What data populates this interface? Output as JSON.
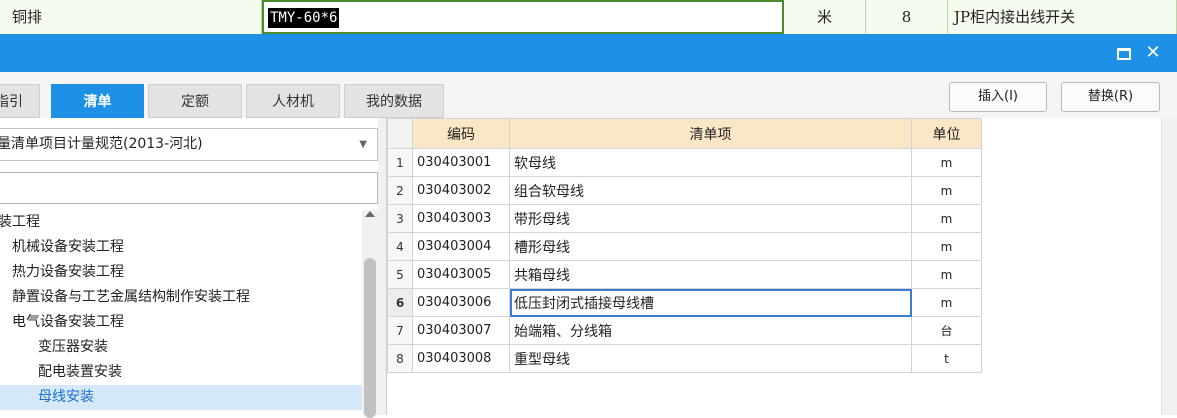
{
  "background_row": {
    "material": "铜排",
    "spec": "TMY-60*6",
    "unit": "米",
    "quantity": "8",
    "description": "JP柜内接出线开关"
  },
  "dialog": {
    "tabs": [
      {
        "label": "指引",
        "active": false
      },
      {
        "label": "清单",
        "active": true
      },
      {
        "label": "定额",
        "active": false
      },
      {
        "label": "人材机",
        "active": false
      },
      {
        "label": "我的数据",
        "active": false
      }
    ],
    "buttons": {
      "insert": "插入(I)",
      "replace": "替换(R)"
    },
    "standard_select": {
      "value": "量清单项目计量规范(2013-河北)"
    },
    "search": {
      "value": "",
      "placeholder": ""
    },
    "tree": [
      {
        "label": "装工程",
        "indent": 0
      },
      {
        "label": "机械设备安装工程",
        "indent": 1
      },
      {
        "label": "热力设备安装工程",
        "indent": 1
      },
      {
        "label": "静置设备与工艺金属结构制作安装工程",
        "indent": 1
      },
      {
        "label": "电气设备安装工程",
        "indent": 1
      },
      {
        "label": "变压器安装",
        "indent": 2
      },
      {
        "label": "配电装置安装",
        "indent": 2
      },
      {
        "label": "母线安装",
        "indent": 2,
        "selected": true
      }
    ],
    "grid": {
      "columns": [
        "编码",
        "清单项",
        "单位"
      ],
      "current_row": 6,
      "rows": [
        {
          "num": "1",
          "code": "030403001",
          "name": "软母线",
          "unit": "m"
        },
        {
          "num": "2",
          "code": "030403002",
          "name": "组合软母线",
          "unit": "m"
        },
        {
          "num": "3",
          "code": "030403003",
          "name": "带形母线",
          "unit": "m"
        },
        {
          "num": "4",
          "code": "030403004",
          "name": "槽形母线",
          "unit": "m"
        },
        {
          "num": "5",
          "code": "030403005",
          "name": "共箱母线",
          "unit": "m"
        },
        {
          "num": "6",
          "code": "030403006",
          "name": "低压封闭式插接母线槽",
          "unit": "m"
        },
        {
          "num": "7",
          "code": "030403007",
          "name": "始端箱、分线箱",
          "unit": "台"
        },
        {
          "num": "8",
          "code": "030403008",
          "name": "重型母线",
          "unit": "t"
        }
      ]
    }
  },
  "colors": {
    "title_bar": "#1e90e6",
    "active_tab": "#1e90e6",
    "header_bg": "#fbe6c6",
    "selected_tree_bg": "#d5e9fb",
    "selected_tree_text": "#1a6fd0"
  }
}
